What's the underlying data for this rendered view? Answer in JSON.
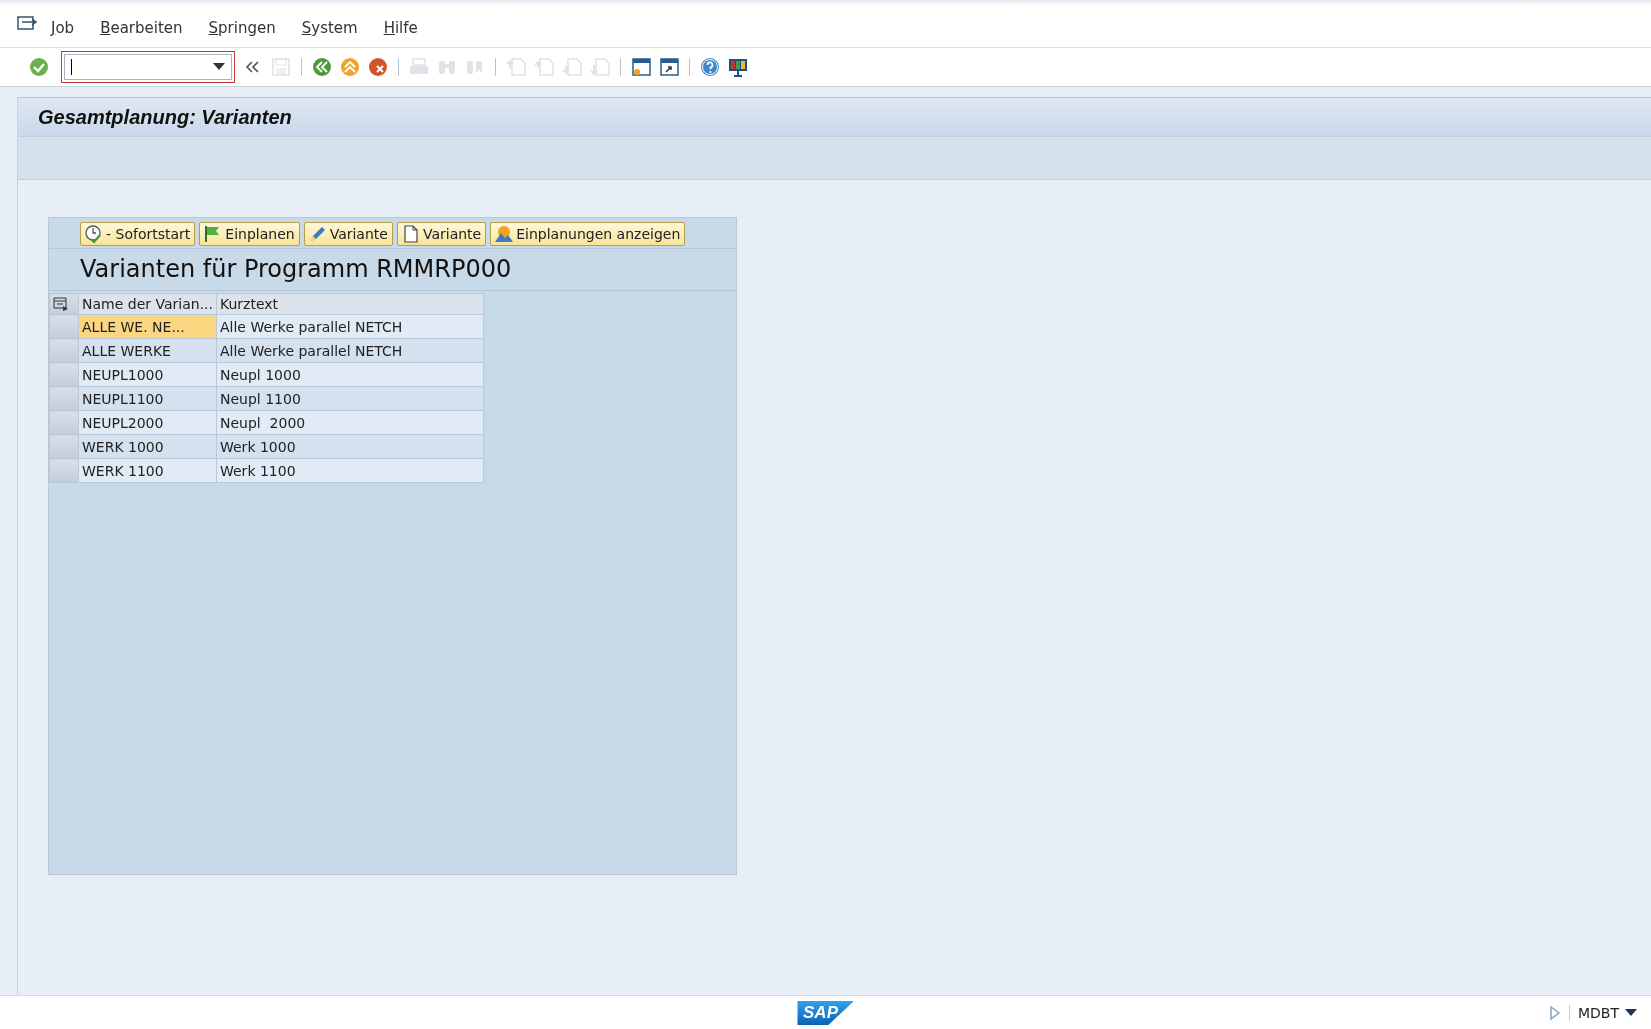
{
  "menu": [
    {
      "label": "Job"
    },
    {
      "label": "Bearbeiten"
    },
    {
      "label": "Springen"
    },
    {
      "label": "System"
    },
    {
      "label": "Hilfe"
    }
  ],
  "toolbar": [
    {
      "kind": "check",
      "disabled": false
    },
    {
      "kind": "command-field"
    },
    {
      "kind": "collapse",
      "disabled": false
    },
    {
      "kind": "save",
      "disabled": true
    },
    {
      "kind": "sep"
    },
    {
      "kind": "back",
      "disabled": false
    },
    {
      "kind": "exit",
      "disabled": false
    },
    {
      "kind": "cancel",
      "disabled": false
    },
    {
      "kind": "sep"
    },
    {
      "kind": "print",
      "disabled": true
    },
    {
      "kind": "find",
      "disabled": true
    },
    {
      "kind": "find-next",
      "disabled": true
    },
    {
      "kind": "sep"
    },
    {
      "kind": "first-page",
      "disabled": true
    },
    {
      "kind": "prev-page",
      "disabled": true
    },
    {
      "kind": "next-page",
      "disabled": true
    },
    {
      "kind": "last-page",
      "disabled": true
    },
    {
      "kind": "sep"
    },
    {
      "kind": "new-session",
      "disabled": false
    },
    {
      "kind": "shortcut",
      "disabled": false
    },
    {
      "kind": "sep"
    },
    {
      "kind": "help",
      "disabled": false
    },
    {
      "kind": "layout",
      "disabled": false
    }
  ],
  "title": "Gesamtplanung: Varianten",
  "alv": {
    "buttons": [
      {
        "kind": "clock",
        "label": "- Sofortstart"
      },
      {
        "kind": "flag",
        "label": "Einplanen"
      },
      {
        "kind": "pencil",
        "label": "Variante"
      },
      {
        "kind": "document",
        "label": "Variante"
      },
      {
        "kind": "mountain",
        "label": "Einplanungen anzeigen"
      }
    ],
    "heading": "Varianten für Programm RMMRP000",
    "columns": [
      "Name der Varian...",
      "Kurztext"
    ],
    "rows": [
      {
        "name": "ALLE WE. NE...",
        "text": "Alle Werke parallel NETCH",
        "selected": true
      },
      {
        "name": "ALLE WERKE",
        "text": "Alle Werke parallel NETCH",
        "selected": false
      },
      {
        "name": "NEUPL1000",
        "text": "Neupl 1000",
        "selected": false
      },
      {
        "name": "NEUPL1100",
        "text": "Neupl 1100",
        "selected": false
      },
      {
        "name": "NEUPL2000",
        "text": "Neupl  2000",
        "selected": false
      },
      {
        "name": "WERK 1000",
        "text": "Werk 1000",
        "selected": false
      },
      {
        "name": "WERK 1100",
        "text": "Werk 1100",
        "selected": false
      }
    ]
  },
  "status": {
    "logo": "SAP",
    "system": "MDBT"
  }
}
